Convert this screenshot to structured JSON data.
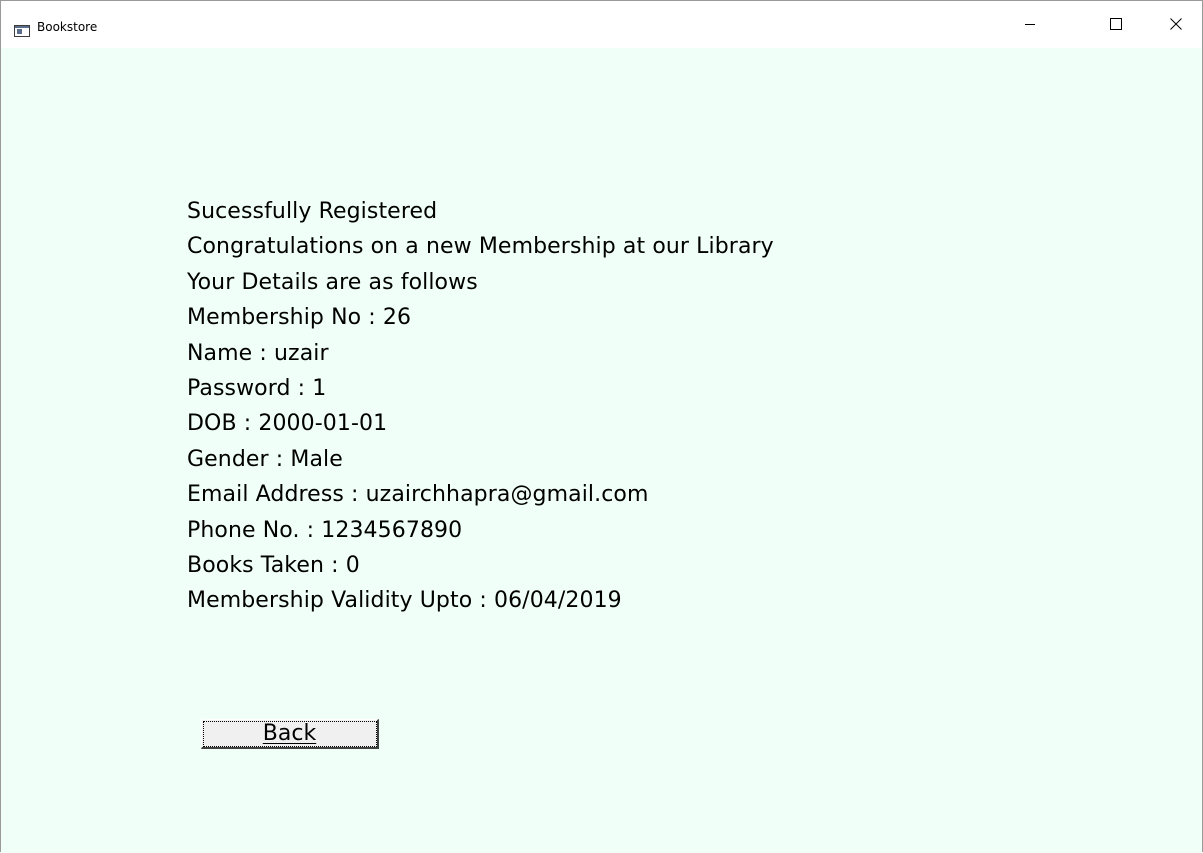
{
  "window": {
    "title": "Bookstore",
    "icon": "app-window-icon",
    "controls": {
      "minimize_icon": "minimize-icon",
      "maximize_icon": "maximize-icon",
      "close_icon": "close-icon"
    }
  },
  "content": {
    "background": "#f0fff8",
    "lines": [
      "Sucessfully Registered",
      "Congratulations on a new Membership at our Library",
      "Your Details are as follows",
      "Membership No : 26",
      "Name : uzair",
      "Password : 1",
      "DOB : 2000-01-01",
      "Gender : Male",
      "Email Address : uzairchhapra@gmail.com",
      "Phone No. : 1234567890",
      "Books Taken : 0",
      "Membership Validity Upto : 06/04/2019"
    ],
    "back_label": "Back"
  }
}
